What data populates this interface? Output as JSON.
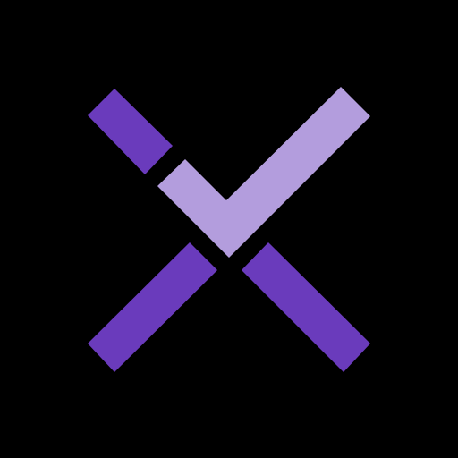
{
  "logo": {
    "icon": "x-checkmark-logo-icon",
    "colors": {
      "background": "#000000",
      "dark_purple": "#6a3bbc",
      "light_purple": "#b39ddd"
    }
  }
}
